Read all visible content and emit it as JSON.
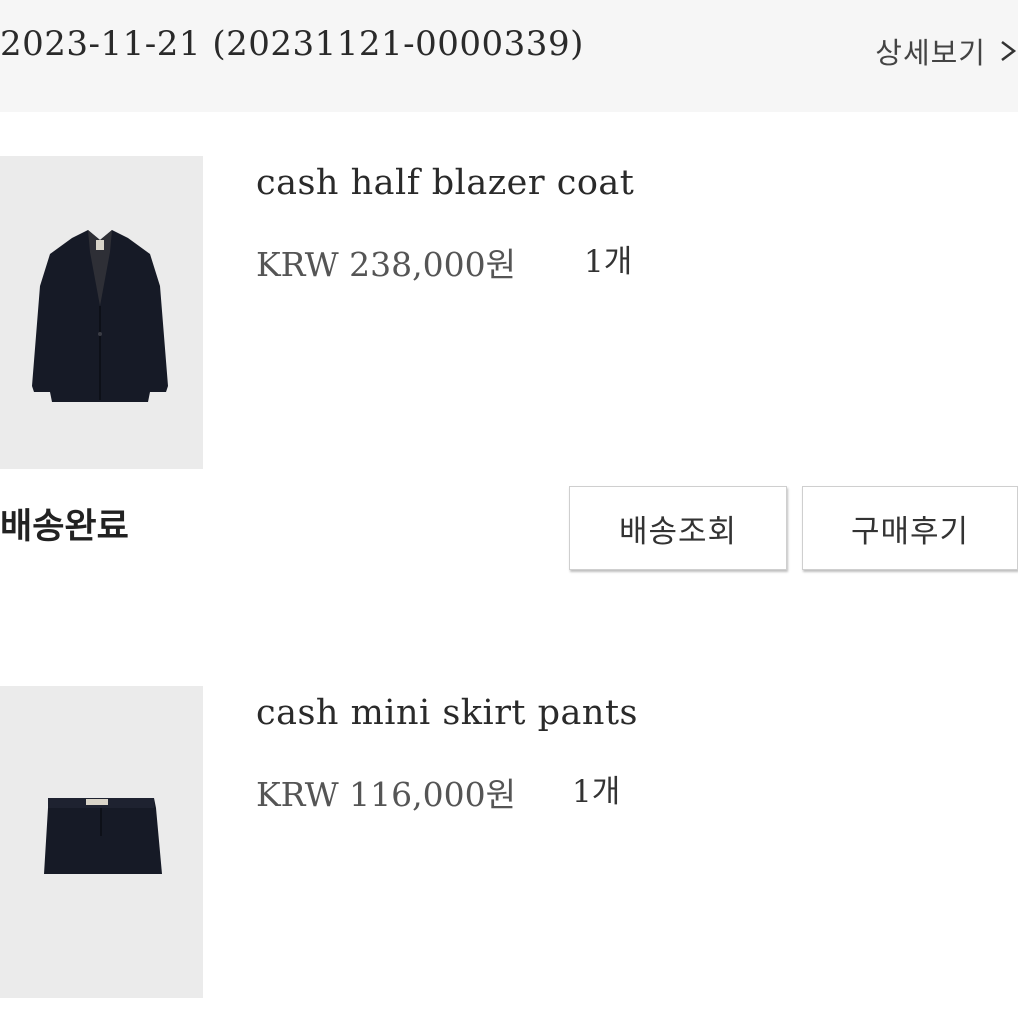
{
  "order": {
    "id_text": "2023-11-21 (20231121-0000339)",
    "detail_label": "상세보기",
    "status": "배송완료"
  },
  "products": [
    {
      "name": "cash half blazer coat",
      "price": "KRW 238,000원",
      "qty": "1개",
      "thumb_icon": "blazer-image"
    },
    {
      "name": "cash mini skirt pants",
      "price": "KRW 116,000원",
      "qty": "1개",
      "thumb_icon": "skirt-image"
    }
  ],
  "actions": {
    "track_label": "배송조회",
    "review_label": "구매후기"
  },
  "colors": {
    "header_bg": "#f6f6f6",
    "thumb_bg": "#ebebeb",
    "garment": "#161a26"
  }
}
